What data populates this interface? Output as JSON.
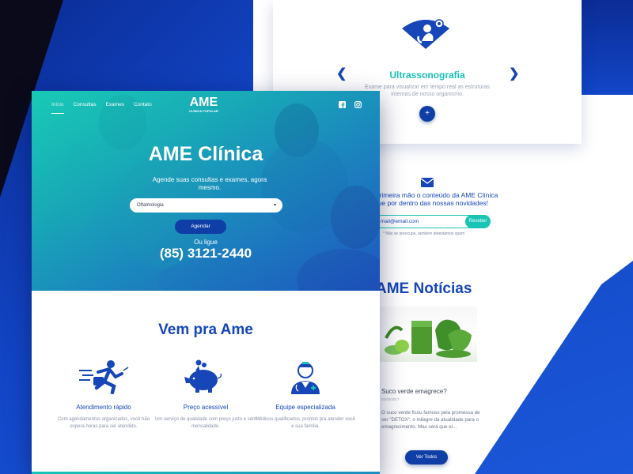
{
  "hero": {
    "nav": [
      "Início",
      "Consultas",
      "Exames",
      "Contato"
    ],
    "logo": {
      "main": "AME",
      "sub_top": "CLÍNICA POPULAR",
      "sub": "CLÍNICA POPULAR"
    },
    "title": "AME Clínica",
    "subtitle": "Agende suas consultas e exames, agora mesmo.",
    "select_value": "Oftalmologia",
    "schedule_button": "Agendar",
    "or_call": "Ou ligue",
    "phone": "(85) 3121-2440"
  },
  "vem": {
    "title": "Vem pra Ame",
    "features": [
      {
        "icon": "running-man-icon",
        "title": "Atendimento rápido",
        "desc": "Com agendamentos organizados, você não espera horas para ser atendido."
      },
      {
        "icon": "piggy-bank-icon",
        "title": "Preço acessível",
        "desc": "Um serviço de qualidade com preço justo e sem mensalidade."
      },
      {
        "icon": "doctor-icon",
        "title": "Equipe especializada",
        "desc": "Médicos qualificados, prontos pra atender você e sua família."
      }
    ]
  },
  "service_card": {
    "title": "Ultrassonografia",
    "desc": "Exame para visualizar em tempo real as estruturas internas de nosso organismo.",
    "plus": "+"
  },
  "newsletter": {
    "text": "Receba em primeira mão o conteúdo da AME Clínica e fique por dentro das nossas novidades!",
    "text_visible": "em primeira mão o conteúdo da AME Clínica\nque por dentro das nossas novidades!",
    "email_placeholder": "mail@email.com",
    "button": "Receber",
    "note": "* Não se preocupe, também detestamos spam"
  },
  "news": {
    "title": "AME Notícias",
    "headline": "Suco verde emagrece?",
    "date": "01/03/2017",
    "body": "O suco verde ficou famoso pela promessa de ser \"DETOX\", o milagre da atualidade para o emagrecimento. Mas será que el...",
    "button": "Ver Todos"
  },
  "colors": {
    "brand_blue": "#1646b8",
    "accent_teal": "#17c4b5",
    "button_blue": "#0f3ea6"
  }
}
